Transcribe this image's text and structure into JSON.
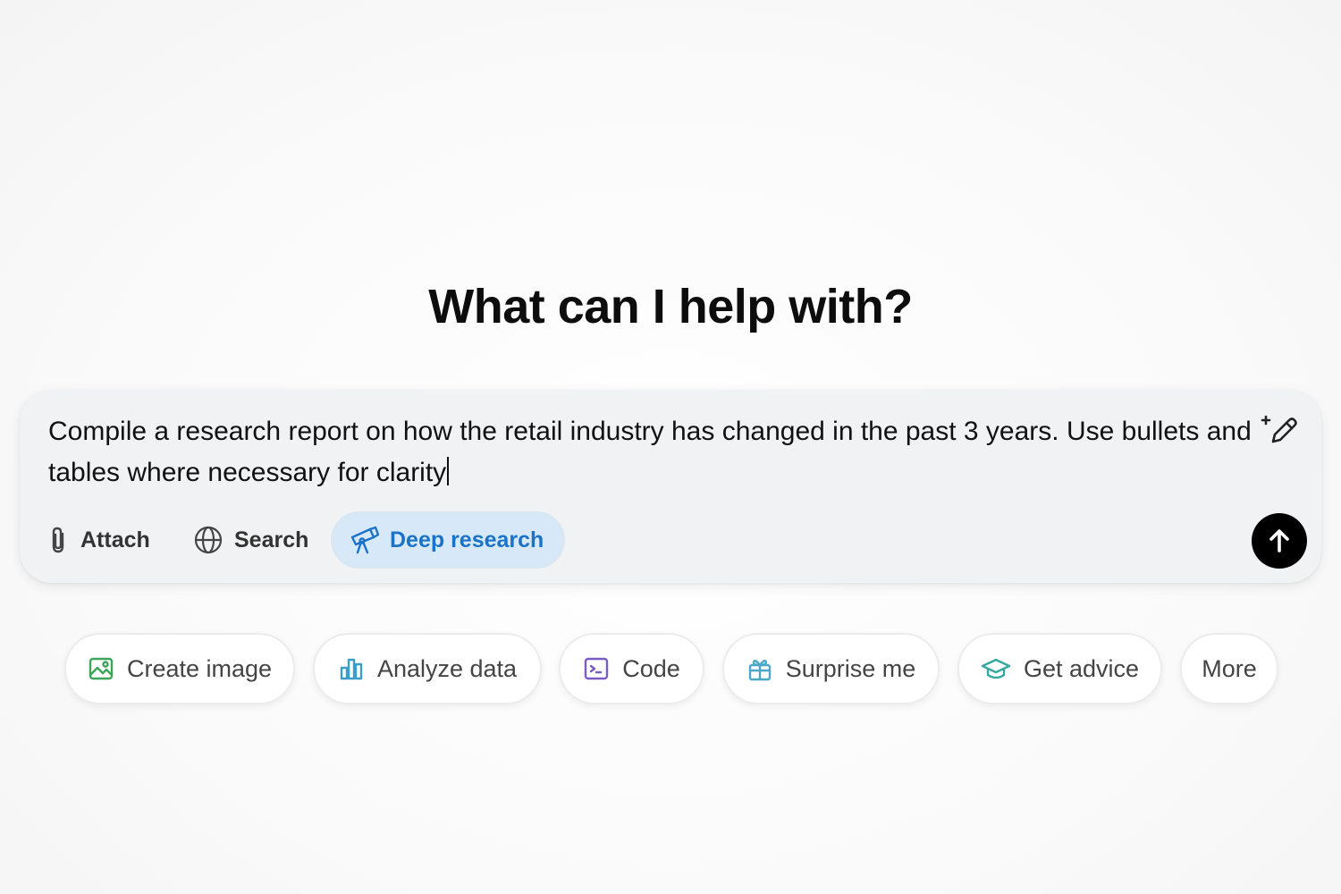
{
  "headline": "What can I help with?",
  "composer": {
    "prompt_text": "Compile a research report on how the retail industry has changed in the past 3 years. Use bullets and tables where necessary for clarity",
    "edit_icon": "magic-pencil-icon",
    "tools": {
      "attach_label": "Attach",
      "search_label": "Search",
      "deep_research_label": "Deep research",
      "deep_research_active": true
    },
    "send_icon": "arrow-up-icon"
  },
  "suggestions": [
    {
      "label": "Create image",
      "icon": "image-icon",
      "color": "#3aa657"
    },
    {
      "label": "Analyze data",
      "icon": "bar-chart-icon",
      "color": "#3b9ec9"
    },
    {
      "label": "Code",
      "icon": "terminal-icon",
      "color": "#7a5cc2"
    },
    {
      "label": "Surprise me",
      "icon": "gift-icon",
      "color": "#4aa8c9"
    },
    {
      "label": "Get advice",
      "icon": "graduation-cap-icon",
      "color": "#35a8a0"
    },
    {
      "label": "More",
      "icon": "",
      "color": ""
    }
  ],
  "colors": {
    "deep_research_bg": "#d7e9f8",
    "deep_research_text": "#1a73c9",
    "send_button": "#000000"
  }
}
